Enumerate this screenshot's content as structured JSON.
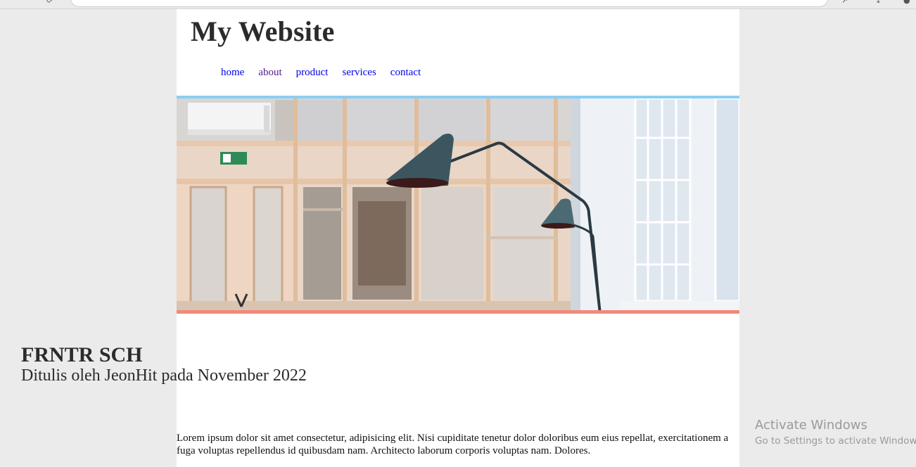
{
  "site": {
    "title": "My Website",
    "nav": [
      {
        "label": "home"
      },
      {
        "label": "about"
      },
      {
        "label": "product"
      },
      {
        "label": "services"
      },
      {
        "label": "contact"
      }
    ]
  },
  "post": {
    "title": "FRNTR SCH",
    "meta": "Ditulis oleh JeonHit pada November 2022",
    "body": "Lorem ipsum dolor sit amet consectetur, adipisicing elit. Nisi cupiditate tenetur dolor doloribus eum eius repellat, exercitationem a fuga voluptas repellendus id quibusdam nam. Architecto laborum corporis voluptas nam. Dolores."
  },
  "overlay": {
    "activate_title": "Activate Windows",
    "activate_sub": "Go to Settings to activate Windows."
  },
  "colors": {
    "hero_top_border": "#8ccdf3",
    "hero_bottom_border": "#f08a7a",
    "link": "#0000ee",
    "visited_link": "#551a8b"
  }
}
